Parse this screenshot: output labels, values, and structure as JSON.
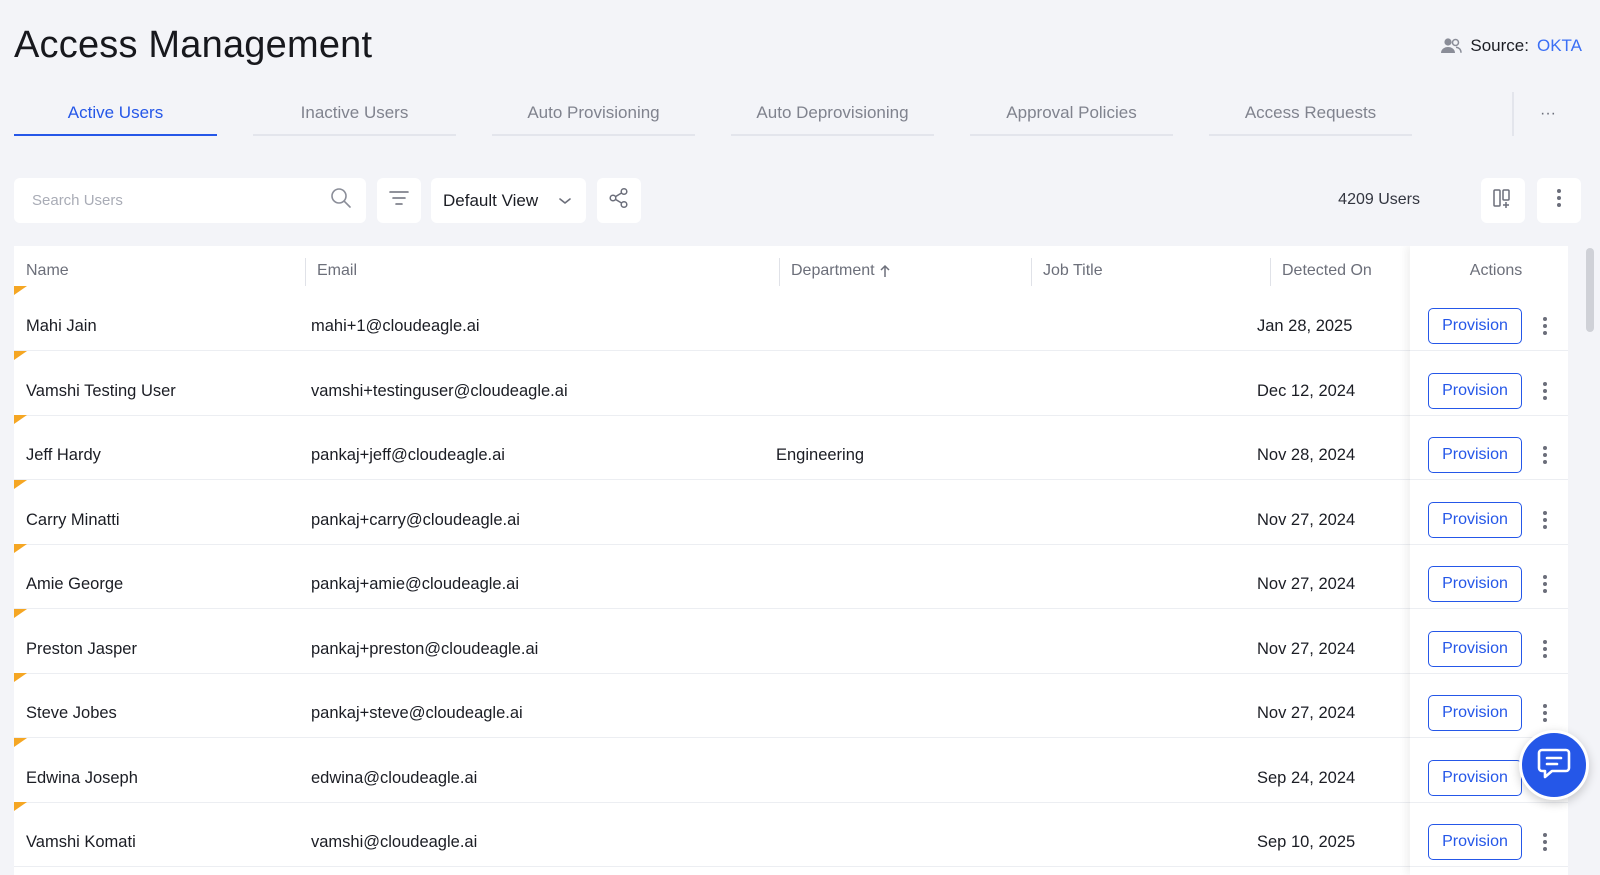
{
  "header": {
    "title": "Access Management",
    "source_label": "Source:",
    "source_value": "OKTA",
    "source_icon": "users-icon"
  },
  "tabs": [
    {
      "label": "Active Users",
      "active": true
    },
    {
      "label": "Inactive Users",
      "active": false
    },
    {
      "label": "Auto Provisioning",
      "active": false
    },
    {
      "label": "Auto Deprovisioning",
      "active": false
    },
    {
      "label": "Approval Policies",
      "active": false
    },
    {
      "label": "Access Requests",
      "active": false
    }
  ],
  "tabs_more_label": "···",
  "toolbar": {
    "search_placeholder": "Search Users",
    "view_label": "Default View",
    "user_count": "4209 Users",
    "icons": [
      "search-icon",
      "filter-icon",
      "chevron-down-icon",
      "share-icon",
      "column-settings-icon",
      "more-vertical-icon"
    ]
  },
  "table": {
    "columns": [
      "Name",
      "Email",
      "Department",
      "Job Title",
      "Detected On"
    ],
    "sorted_column": "Department",
    "sort_direction": "ascending",
    "actions_header": "Actions",
    "action_button_label": "Provision",
    "rows": [
      {
        "name": "Mahi Jain",
        "email": "mahi+1@cloudeagle.ai",
        "department": "",
        "job_title": "",
        "detected_on": "Jan 28, 2025"
      },
      {
        "name": "Vamshi Testing User",
        "email": "vamshi+testinguser@cloudeagle.ai",
        "department": "",
        "job_title": "",
        "detected_on": "Dec 12, 2024"
      },
      {
        "name": "Jeff Hardy",
        "email": "pankaj+jeff@cloudeagle.ai",
        "department": "Engineering",
        "job_title": "",
        "detected_on": "Nov 28, 2024"
      },
      {
        "name": "Carry Minatti",
        "email": "pankaj+carry@cloudeagle.ai",
        "department": "",
        "job_title": "",
        "detected_on": "Nov 27, 2024"
      },
      {
        "name": "Amie George",
        "email": "pankaj+amie@cloudeagle.ai",
        "department": "",
        "job_title": "",
        "detected_on": "Nov 27, 2024"
      },
      {
        "name": "Preston Jasper",
        "email": "pankaj+preston@cloudeagle.ai",
        "department": "",
        "job_title": "",
        "detected_on": "Nov 27, 2024"
      },
      {
        "name": "Steve Jobes",
        "email": "pankaj+steve@cloudeagle.ai",
        "department": "",
        "job_title": "",
        "detected_on": "Nov 27, 2024"
      },
      {
        "name": "Edwina Joseph",
        "email": "edwina@cloudeagle.ai",
        "department": "",
        "job_title": "",
        "detected_on": "Sep 24, 2024"
      },
      {
        "name": "Vamshi Komati",
        "email": "vamshi@cloudeagle.ai",
        "department": "",
        "job_title": "",
        "detected_on": "Sep 10, 2025"
      }
    ]
  },
  "colors": {
    "accent": "#2557e8",
    "source_link": "#3b6ff5",
    "row_flag": "#f5a623",
    "background": "#f3f4f8"
  },
  "chat_icon": "chat-icon"
}
